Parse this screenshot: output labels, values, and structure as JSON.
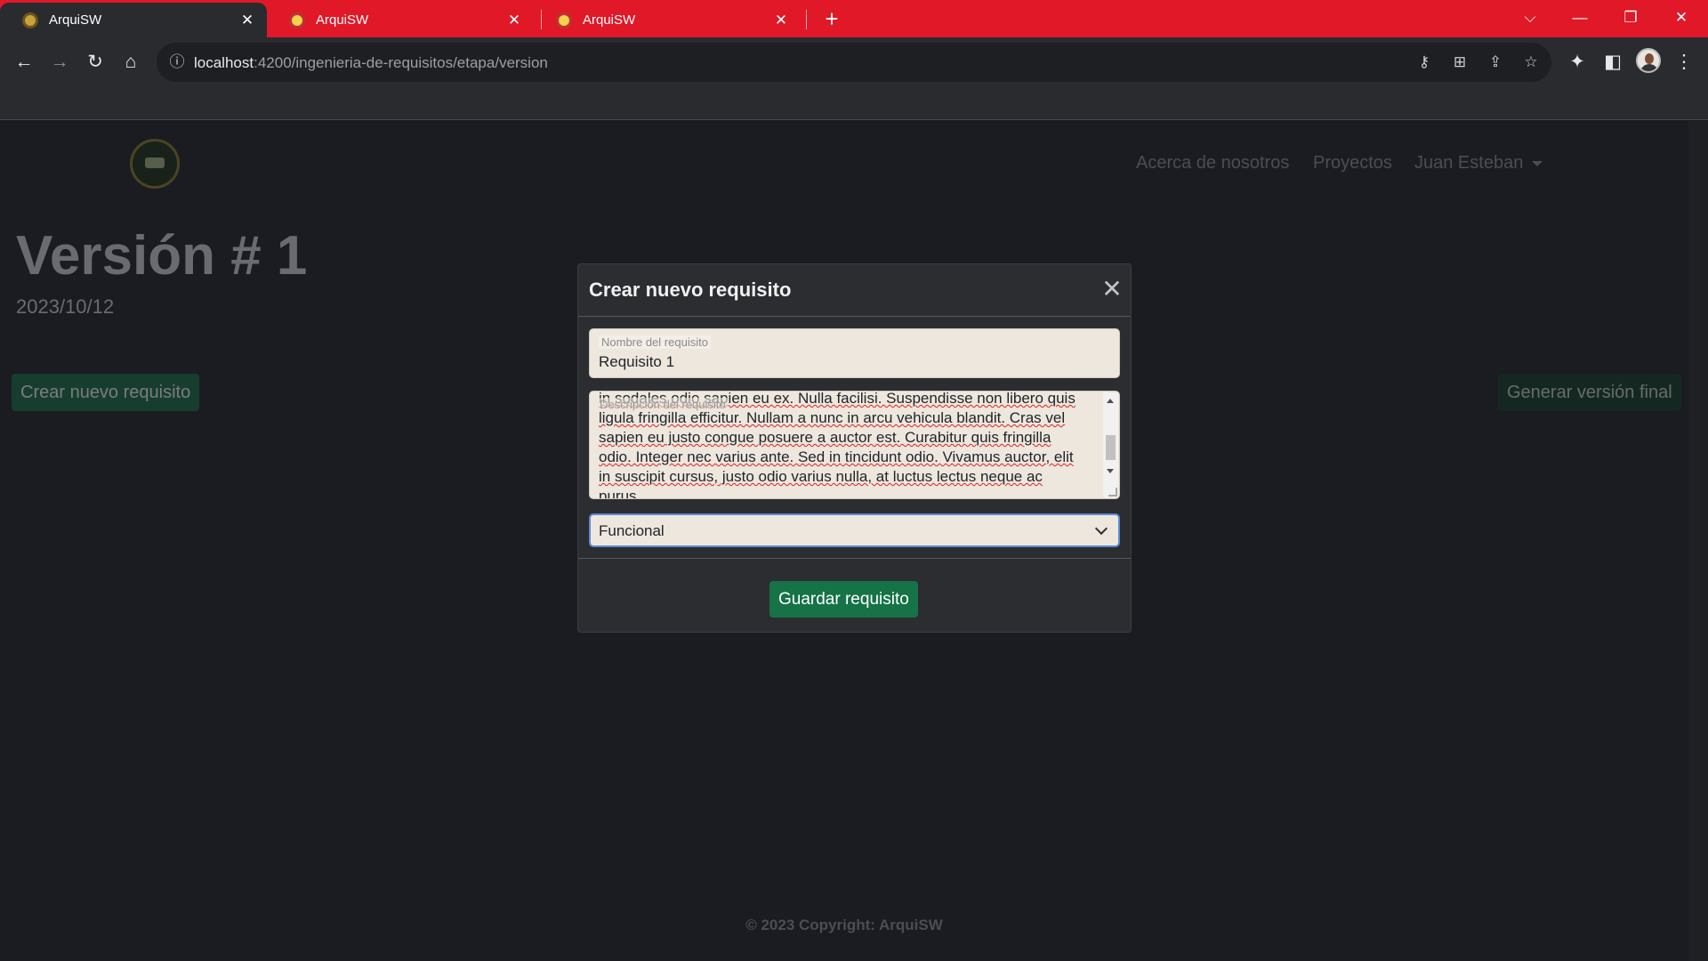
{
  "browser": {
    "tabs": [
      {
        "title": "ArquiSW",
        "active": true
      },
      {
        "title": "ArquiSW",
        "active": false
      },
      {
        "title": "ArquiSW",
        "active": false
      }
    ],
    "url_host": "localhost",
    "url_path": ":4200/ingenieria-de-requisitos/etapa/version"
  },
  "navbar": {
    "links": [
      "Acerca de nosotros",
      "Proyectos"
    ],
    "user": "Juan Esteban"
  },
  "page": {
    "version_title": "Versión # 1",
    "date": "2023/10/12",
    "create_button": "Crear nuevo requisito",
    "final_button": "Generar versión final"
  },
  "modal": {
    "title": "Crear nuevo requisito",
    "name_label": "Nombre del requisito",
    "name_value": "Requisito 1",
    "description_label": "Descripción del requisito",
    "description_lines": [
      "in sodales odio sapien eu ex. Nulla facilisi. Suspendisse non libero quis",
      "ligula fringilla efficitur. Nullam a nunc in arcu vehicula blandit. Cras vel",
      "sapien eu justo congue posuere a auctor est. Curabitur quis fringilla",
      "odio. Integer nec varius ante. Sed in tincidunt odio. Vivamus auctor, elit",
      "in suscipit cursus, justo odio varius nulla, at luctus lectus neque ac",
      "purus."
    ],
    "type_selected": "Funcional",
    "save_button": "Guardar requisito"
  },
  "footer": {
    "text": "© 2023 Copyright: ArquiSW"
  },
  "colors": {
    "tabbar": "#e01828",
    "primary_green": "#146c43",
    "modal_bg": "#2b2d31",
    "page_bg": "#1b1c21"
  }
}
